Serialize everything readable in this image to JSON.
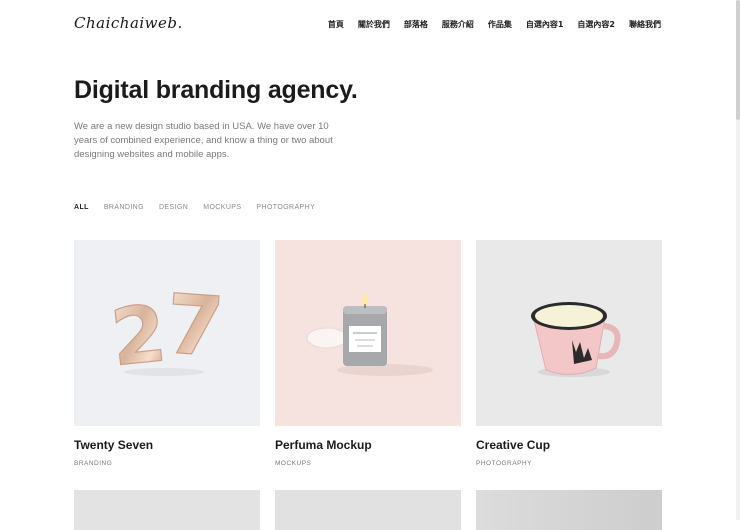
{
  "brand": {
    "logo": "Chaichaiweb."
  },
  "nav": [
    {
      "label": "首頁"
    },
    {
      "label": "關於我們"
    },
    {
      "label": "部落格"
    },
    {
      "label": "服務介紹"
    },
    {
      "label": "作品集"
    },
    {
      "label": "自選內容1"
    },
    {
      "label": "自選內容2"
    },
    {
      "label": "聯絡我們"
    }
  ],
  "hero": {
    "title": "Digital branding agency.",
    "desc": "We are a new design studio based in USA. We have over 10 years of combined experience, and know a thing or two about designing websites and mobile apps."
  },
  "filters": [
    {
      "label": "ALL",
      "active": true
    },
    {
      "label": "BRANDING"
    },
    {
      "label": "DESIGN"
    },
    {
      "label": "MOCKUPS"
    },
    {
      "label": "PHOTOGRAPHY"
    }
  ],
  "portfolio": [
    {
      "title": "Twenty Seven",
      "category": "BRANDING",
      "bg": "#eef0f3"
    },
    {
      "title": "Perfuma Mockup",
      "category": "MOCKUPS",
      "bg": "#f6e3e0"
    },
    {
      "title": "Creative Cup",
      "category": "PHOTOGRAPHY",
      "bg": "#e9e9e9"
    }
  ],
  "colors": {
    "accent": "#1b1b1b",
    "muted": "#7a7a7a"
  }
}
